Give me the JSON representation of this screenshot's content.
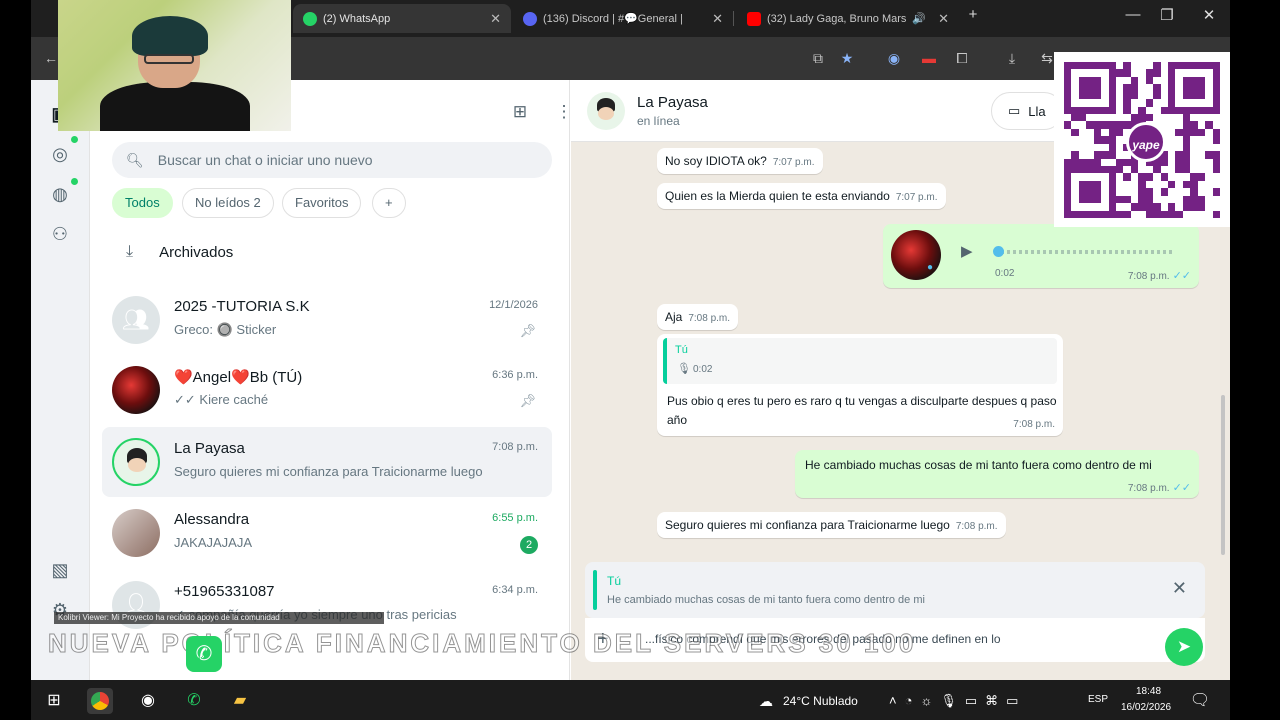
{
  "browser": {
    "tabs": [
      {
        "label": "(2) WhatsApp",
        "icon": "whatsapp-icon",
        "active": true
      },
      {
        "label": "(136) Discord | #💬General |",
        "icon": "discord-icon",
        "active": false
      },
      {
        "label": "(32) Lady Gaga, Bruno Mars",
        "icon": "youtube-icon",
        "active": false
      }
    ],
    "new_tab": "+",
    "window_controls": {
      "minimize": "—",
      "restore": "❐",
      "close": "✕"
    }
  },
  "whatsapp": {
    "rail": {
      "icons": [
        "chats-icon",
        "status-icon",
        "channels-icon",
        "communities-icon",
        "media-icon",
        "settings-icon"
      ]
    },
    "chatlist": {
      "search_placeholder": "Buscar un chat o iniciar uno nuevo",
      "filters": [
        "Todos",
        "No leídos 2",
        "Favoritos",
        "+"
      ],
      "archived_label": "Archivados",
      "chats": [
        {
          "name": "2025 -TUTORIA S.K",
          "preview": "Greco: 🔘 Sticker",
          "time": "12/1/2026",
          "pinned": true,
          "avatar": "group-avatar-icon"
        },
        {
          "name": "❤️Angel❤️Bb (TÚ)",
          "preview": "✓✓ Kiere caché",
          "time": "6:36 p.m.",
          "pinned": true,
          "avatar": "red-abstract"
        },
        {
          "name": "La Payasa",
          "preview": "Seguro quieres mi confianza para Traicionarme luego",
          "time": "7:08 p.m.",
          "selected": true,
          "avatar": "photo"
        },
        {
          "name": "Alessandra",
          "preview": "JAKAJAJAJA",
          "time": "6:55 p.m.",
          "unread": 2,
          "avatar": "photo"
        },
        {
          "name": "+51965331087",
          "preview": "✓ compañía querría yo siempre uno tras pericias",
          "time": "6:34 p.m.",
          "avatar": "default-avatar-icon"
        }
      ]
    },
    "conversation": {
      "contact_name": "La Payasa",
      "contact_status": "en línea",
      "call_button": "Lla",
      "messages": [
        {
          "dir": "in",
          "text": "No soy IDIOTA ok?",
          "time": "7:07 p.m."
        },
        {
          "dir": "in",
          "text": "Quien es la Mierda quien te esta enviando",
          "time": "7:07 p.m."
        },
        {
          "dir": "out",
          "type": "voice",
          "duration": "0:02",
          "time": "7:08 p.m."
        },
        {
          "dir": "in",
          "text": "Aja",
          "time": "7:08 p.m."
        },
        {
          "dir": "in",
          "quote_author": "Tú",
          "quote_text": "0:02",
          "text": "Pus obio q eres tu pero es raro q tu vengas a disculparte despues q paso año",
          "time": "7:08 p.m."
        },
        {
          "dir": "out",
          "text": "He cambiado muchas cosas de mi tanto fuera como dentro de mi",
          "time": "7:08 p.m."
        },
        {
          "dir": "in",
          "text": "Seguro quieres mi confianza para Traicionarme luego",
          "time": "7:08 p.m."
        }
      ],
      "reply_preview": {
        "author": "Tú",
        "text": "He cambiado muchas cosas de mi tanto fuera como dentro de mi"
      },
      "draft": "...físico comprendí que mis errores del pasado no me definen en lo"
    }
  },
  "overlays": {
    "banner": "NUEVA POLÍTICA FINANCIAMIENTO DEL SERVERS 30 100",
    "ticker": "Kolibri   Viewer: Mi Proyecto ha recibido apoyo de la comunidad",
    "qr_badge": "yape"
  },
  "taskbar": {
    "weather": "24°C  Nublado",
    "language": "ESP",
    "time": "18:48",
    "date": "16/02/2026"
  },
  "colors": {
    "whatsapp_green": "#25d366",
    "outgoing_bubble": "#d9fdd3",
    "chat_bg": "#efeae2",
    "yape_purple": "#742284"
  }
}
